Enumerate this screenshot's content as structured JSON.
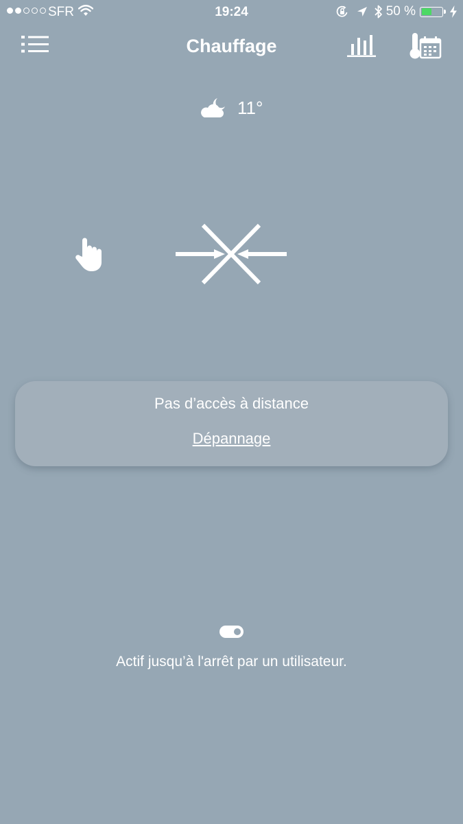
{
  "status_bar": {
    "carrier": "SFR",
    "signal_bars_filled": 2,
    "signal_bars_total": 5,
    "time": "19:24",
    "battery_percent": "50 %",
    "battery_level": 0.5,
    "battery_color": "#4cd964",
    "icons": [
      "wifi-icon",
      "orientation-lock-icon",
      "location-icon",
      "bluetooth-icon",
      "battery-icon",
      "charging-bolt-icon"
    ]
  },
  "nav": {
    "title": "Chauffage",
    "left_icon": "menu-list-icon",
    "right_icons": [
      "stats-chart-icon",
      "thermometer-calendar-icon"
    ]
  },
  "weather": {
    "icon": "cloud-moon-icon",
    "temperature": "11°"
  },
  "mode": {
    "icon": "hand-pointer-icon",
    "status_icon": "no-connection-arrows-icon"
  },
  "remote_card": {
    "title": "Pas d’accès à distance",
    "link": "Dépannage"
  },
  "footer": {
    "toggle_on": true,
    "active_text": "Actif jusqu’à l'arrêt par un utilisateur."
  },
  "colors": {
    "background": "#96a7b4",
    "card": "#a2afba",
    "foreground": "#ffffff"
  }
}
